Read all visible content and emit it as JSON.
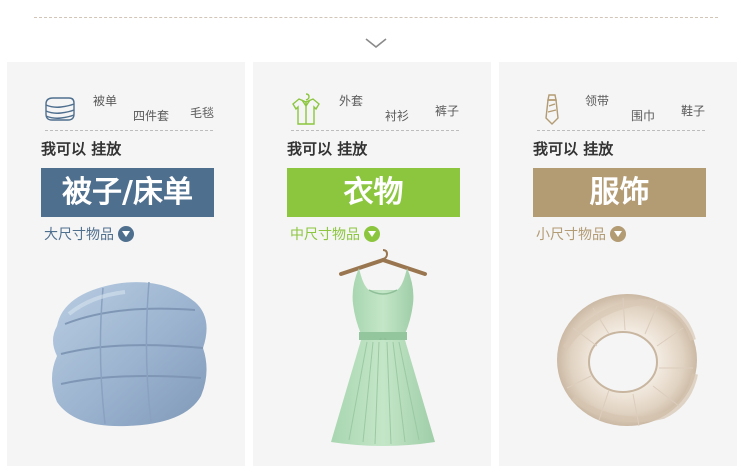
{
  "colors": {
    "blue": "#4f6f8f",
    "green": "#8cc63f",
    "tan": "#b39b73",
    "dashed_rule": "#d2c5b8",
    "card_bg": "#f5f5f5"
  },
  "cards": [
    {
      "icon": "folded-bedding-icon",
      "tags": [
        "被单",
        "四件套",
        "毛毯"
      ],
      "can_hang": "我可以  挂放",
      "title": "被子/床单",
      "size_label": "大尺寸物品",
      "accent": "#4f6f8f",
      "image": "folded-duvet-image"
    },
    {
      "icon": "shirt-hanger-icon",
      "tags": [
        "外套",
        "衬衫",
        "裤子"
      ],
      "can_hang": "我可以  挂放",
      "title": "衣物",
      "size_label": "中尺寸物品",
      "accent": "#8cc63f",
      "image": "green-dress-image"
    },
    {
      "icon": "tie-icon",
      "tags": [
        "领带",
        "围巾",
        "鞋子"
      ],
      "can_hang": "我可以  挂放",
      "title": "服饰",
      "size_label": "小尺寸物品",
      "accent": "#b39b73",
      "image": "knit-scarf-image"
    }
  ]
}
